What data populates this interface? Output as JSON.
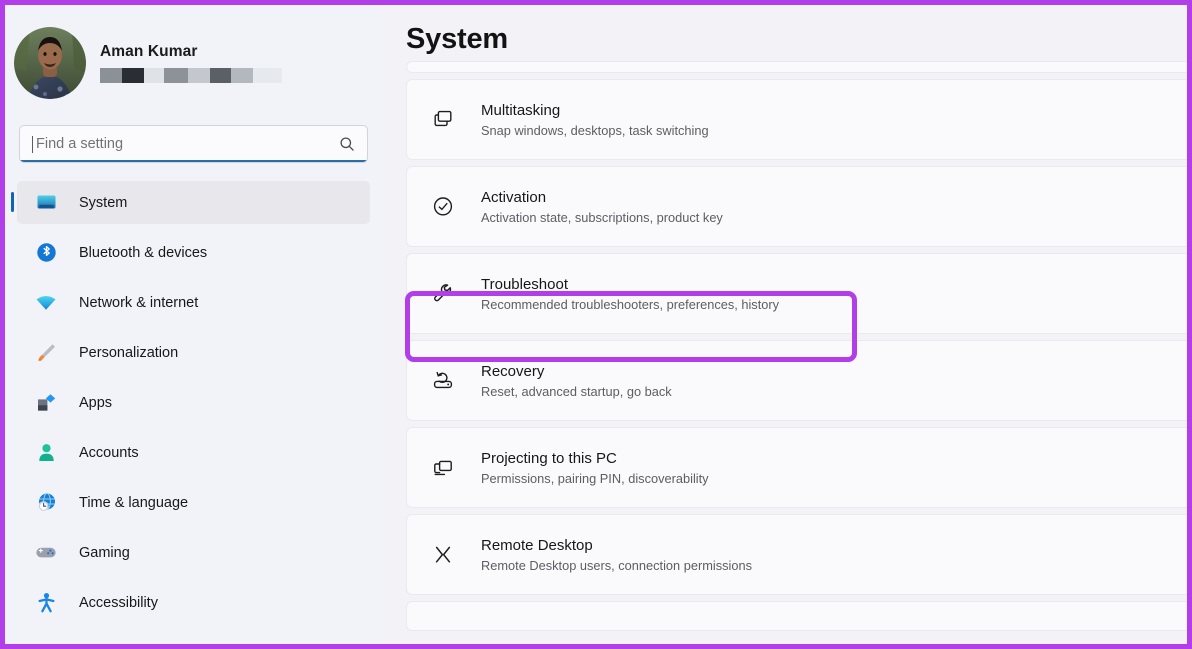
{
  "window": {
    "accent_border_color": "#b13ee8",
    "background_color": "#f3f3f7"
  },
  "sidebar": {
    "profile": {
      "name": "Aman Kumar",
      "email_redacted": true,
      "redaction_blocks": [
        "#8c9197",
        "#2a2d33",
        "#dfe2e7",
        "#8d9299",
        "#c4c8ce",
        "#5b5f66",
        "#b3b8bf",
        "#e6e9ee"
      ],
      "avatar_icon": "user-photo"
    },
    "search": {
      "placeholder": "Find a setting",
      "value": "",
      "focused": true,
      "icon": "search-icon",
      "underline_color": "#2a6fa8"
    },
    "selected_item": "System",
    "selection_accent_color": "#0f66b5",
    "items": [
      {
        "label": "System",
        "icon": "system-icon",
        "selected": true
      },
      {
        "label": "Bluetooth & devices",
        "icon": "bluetooth-icon",
        "selected": false
      },
      {
        "label": "Network & internet",
        "icon": "network-icon",
        "selected": false
      },
      {
        "label": "Personalization",
        "icon": "personalization-brush-icon",
        "selected": false
      },
      {
        "label": "Apps",
        "icon": "apps-icon",
        "selected": false
      },
      {
        "label": "Accounts",
        "icon": "accounts-person-icon",
        "selected": false
      },
      {
        "label": "Time & language",
        "icon": "time-language-globe-icon",
        "selected": false
      },
      {
        "label": "Gaming",
        "icon": "gaming-controller-icon",
        "selected": false
      },
      {
        "label": "Accessibility",
        "icon": "accessibility-person-icon",
        "selected": false
      }
    ]
  },
  "main": {
    "title": "System",
    "scrolled": true,
    "rows": [
      {
        "title": "Multitasking",
        "subtitle": "Snap windows, desktops, task switching",
        "icon": "multitasking-windows-icon",
        "chevron": "chevron-right-icon",
        "highlighted": false
      },
      {
        "title": "Activation",
        "subtitle": "Activation state, subscriptions, product key",
        "icon": "activation-check-circle-icon",
        "chevron": "chevron-right-icon",
        "highlighted": false
      },
      {
        "title": "Troubleshoot",
        "subtitle": "Recommended troubleshooters, preferences, history",
        "icon": "troubleshoot-wrench-icon",
        "chevron": "chevron-right-icon",
        "highlighted": true
      },
      {
        "title": "Recovery",
        "subtitle": "Reset, advanced startup, go back",
        "icon": "recovery-drive-icon",
        "chevron": "chevron-right-icon",
        "highlighted": false
      },
      {
        "title": "Projecting to this PC",
        "subtitle": "Permissions, pairing PIN, discoverability",
        "icon": "projecting-screens-icon",
        "chevron": "chevron-right-icon",
        "highlighted": false
      },
      {
        "title": "Remote Desktop",
        "subtitle": "Remote Desktop users, connection permissions",
        "icon": "remote-desktop-chevrons-icon",
        "chevron": "chevron-right-icon",
        "highlighted": false
      }
    ]
  }
}
